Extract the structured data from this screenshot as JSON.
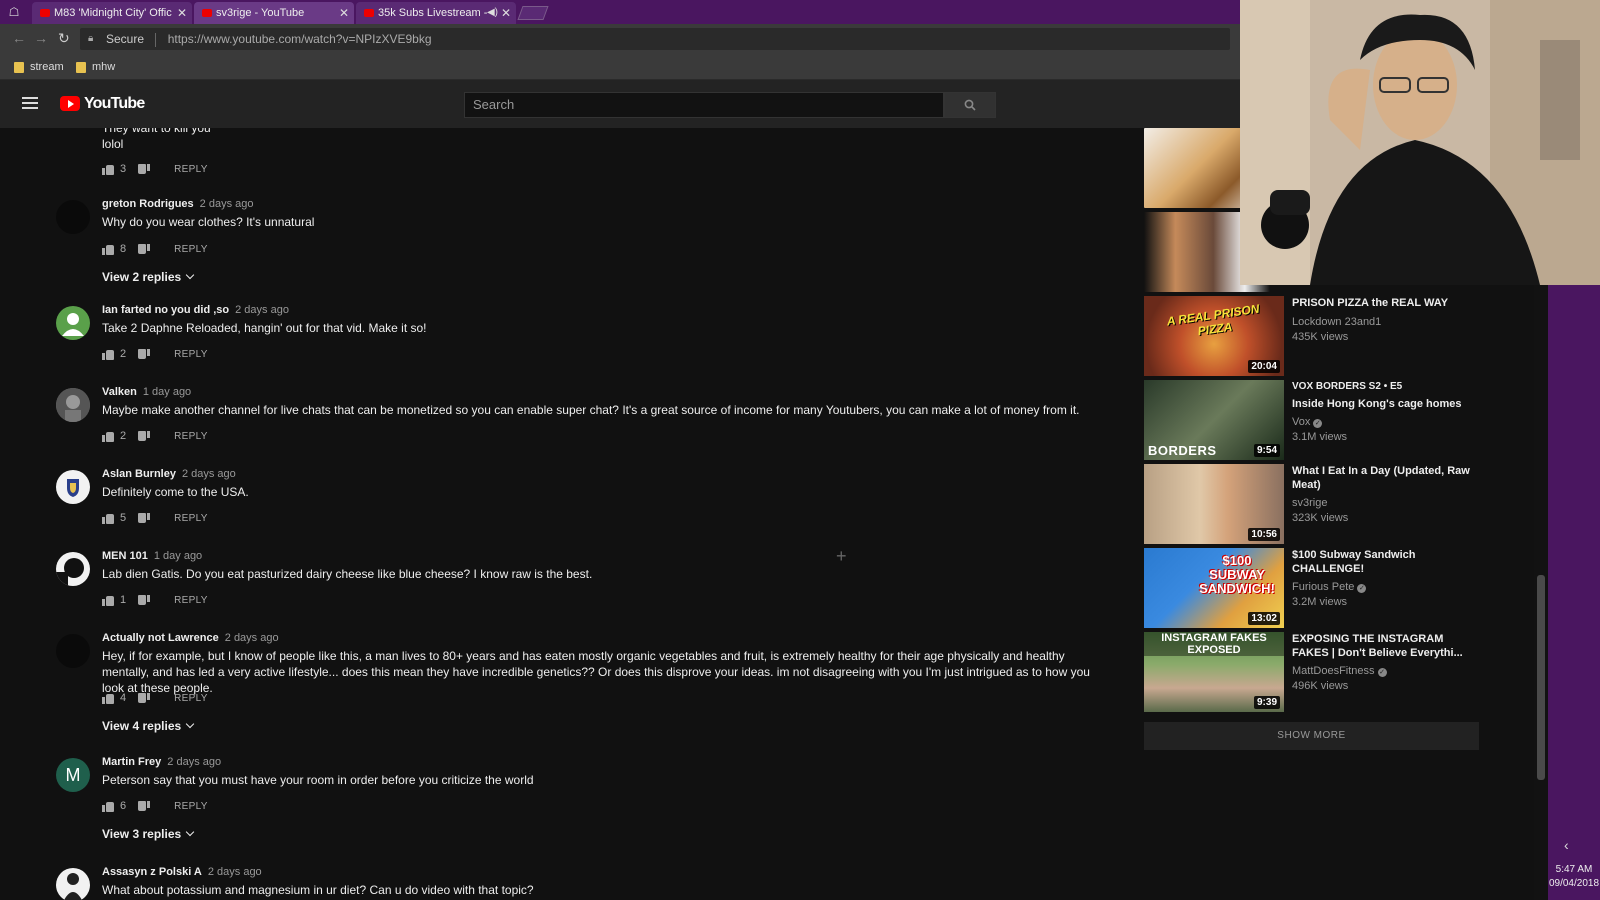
{
  "browser": {
    "tabs": [
      {
        "title": "M83 'Midnight City' Offic",
        "active": false
      },
      {
        "title": "sv3rige - YouTube",
        "active": true
      },
      {
        "title": "35k Subs Livestream -",
        "active": false
      }
    ],
    "address": {
      "secure_label": "Secure",
      "url": "https://www.youtube.com/watch?v=NPIzXVE9bkg"
    },
    "bookmarks": [
      "stream",
      "mhw"
    ]
  },
  "masthead": {
    "logo": "YouTube",
    "search_placeholder": "Search"
  },
  "comments": {
    "fragment_text": "They want to kill you\nlolol",
    "fragment_likes": "3",
    "reply_label": "REPLY",
    "items": [
      {
        "author": "greton Rodrigues",
        "time": "2 days ago",
        "text": "Why do you wear clothes? It's unnatural",
        "likes": "8",
        "view_replies": "View 2 replies"
      },
      {
        "author": "Ian farted no you did ,so",
        "time": "2 days ago",
        "text": "Take 2 Daphne Reloaded, hangin' out for that vid. Make it so!",
        "likes": "2"
      },
      {
        "author": "Valken",
        "time": "1 day ago",
        "text": "Maybe make another channel for live chats that can be monetized so you can enable super chat? It's a great source of income for many Youtubers, you can make a lot of money from it.",
        "likes": "2"
      },
      {
        "author": "Aslan Burnley",
        "time": "2 days ago",
        "text": "Definitely come to the USA.",
        "likes": "5"
      },
      {
        "author": "MEN 101",
        "time": "1 day ago",
        "text": "Lab dien Gatis. Do you eat pasturized dairy cheese like blue cheese? I know raw is the best.",
        "likes": "1"
      },
      {
        "author": "Actually not Lawrence",
        "time": "2 days ago",
        "text": "Hey, if for example, but I know of people like this, a man lives to 80+ years and has eaten mostly organic vegetables and fruit, is extremely healthy for their age physically and healthy mentally, and has led a very active lifestyle... does this mean they have incredible genetics?? Or does this disprove your ideas. im not disagreeing with you I'm just intrigued as to how you look at these people.",
        "likes": "4",
        "view_replies": "View 4 replies"
      },
      {
        "author": "Martin Frey",
        "time": "2 days ago",
        "text": "Peterson say that you must have your room in order before you criticize the world",
        "likes": "6",
        "avatar_letter": "M",
        "view_replies": "View 3 replies"
      },
      {
        "author": "Assasyn z Polski A",
        "time": "2 days ago",
        "text": "What about potassium and magnesium in ur diet? Can u do video with that topic?"
      }
    ]
  },
  "sidebar": {
    "videos": [
      {
        "title": "PRISON PIZZA the REAL WAY",
        "channel": "Lockdown 23and1",
        "views": "435K views",
        "duration": "20:04",
        "thumb_text": "A REAL PRISON PIZZA"
      },
      {
        "supertitle": "VOX BORDERS  S2 • E5",
        "title": "Inside Hong Kong's cage homes",
        "channel": "Vox",
        "verified": true,
        "views": "3.1M views",
        "duration": "9:54",
        "thumb_text": "BORDERS"
      },
      {
        "title": "What I Eat In a Day (Updated, Raw Meat)",
        "channel": "sv3rige",
        "views": "323K views",
        "duration": "10:56"
      },
      {
        "title": "$100 Subway Sandwich CHALLENGE!",
        "channel": "Furious Pete",
        "verified": true,
        "views": "3.2M views",
        "duration": "13:02",
        "thumb_text": "$100 SUBWAY SANDWICH!"
      },
      {
        "title": "EXPOSING THE INSTAGRAM FAKES | Don't Believe Everythi...",
        "channel": "MattDoesFitness",
        "verified": true,
        "views": "496K views",
        "duration": "9:39",
        "thumb_text": "INSTAGRAM FAKES EXPOSED"
      }
    ],
    "show_more": "SHOW MORE"
  },
  "taskbar": {
    "time": "5:47 AM",
    "date": "09/04/2018"
  },
  "colors": {
    "purple": "#4a1660",
    "youtube_red": "#ff0000",
    "dark_bg": "#111111"
  }
}
